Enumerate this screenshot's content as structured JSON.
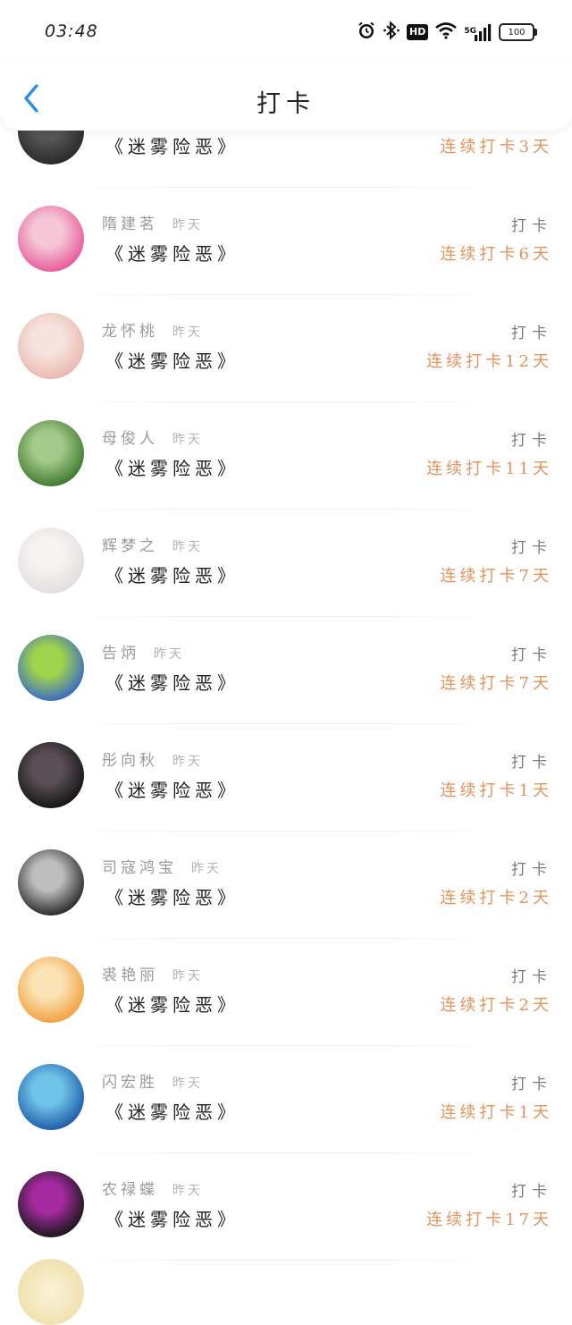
{
  "status_bar": {
    "time": "03:48",
    "icons": [
      "alarm-icon",
      "bluetooth-icon",
      "hd-icon",
      "wifi-icon",
      "5g-signal-icon",
      "battery-icon"
    ],
    "hd_label": "HD",
    "network_label": "5G",
    "battery_level": "100"
  },
  "header": {
    "title": "打卡",
    "back_icon": "chevron-left-icon",
    "accent_color": "#2f8fe0"
  },
  "colors": {
    "streak": "#e3935c",
    "name": "#9a9a9a",
    "checkin": "#7d7d7d"
  },
  "records": [
    {
      "name": "",
      "time": "",
      "book": "《迷雾险恶》",
      "checkin": "",
      "streak": "连续打卡3天",
      "avatar_colors": [
        "#2a2a2a",
        "#555555"
      ]
    },
    {
      "name": "隋建茗",
      "time": "昨天",
      "book": "《迷雾险恶》",
      "checkin": "打卡",
      "streak": "连续打卡6天",
      "avatar_colors": [
        "#e85a9a",
        "#f4c6d6"
      ]
    },
    {
      "name": "龙怀桃",
      "time": "昨天",
      "book": "《迷雾险恶》",
      "checkin": "打卡",
      "streak": "连续打卡12天",
      "avatar_colors": [
        "#e9b9b0",
        "#f7e3dd"
      ]
    },
    {
      "name": "母俊人",
      "time": "昨天",
      "book": "《迷雾险恶》",
      "checkin": "打卡",
      "streak": "连续打卡11天",
      "avatar_colors": [
        "#3f7a2e",
        "#a4c98a"
      ]
    },
    {
      "name": "辉梦之",
      "time": "昨天",
      "book": "《迷雾险恶》",
      "checkin": "打卡",
      "streak": "连续打卡7天",
      "avatar_colors": [
        "#e2dede",
        "#f6f3f3"
      ]
    },
    {
      "name": "告炳",
      "time": "昨天",
      "book": "《迷雾险恶》",
      "checkin": "打卡",
      "streak": "连续打卡7天",
      "avatar_colors": [
        "#3a6bc4",
        "#9fd34b"
      ]
    },
    {
      "name": "彤向秋",
      "time": "昨天",
      "book": "《迷雾险恶》",
      "checkin": "打卡",
      "streak": "连续打卡1天",
      "avatar_colors": [
        "#151515",
        "#5a4f55"
      ]
    },
    {
      "name": "司寇鸿宝",
      "time": "昨天",
      "book": "《迷雾险恶》",
      "checkin": "打卡",
      "streak": "连续打卡2天",
      "avatar_colors": [
        "#2a2a2a",
        "#bdbdbd"
      ]
    },
    {
      "name": "裘艳丽",
      "time": "昨天",
      "book": "《迷雾险恶》",
      "checkin": "打卡",
      "streak": "连续打卡2天",
      "avatar_colors": [
        "#f2a041",
        "#fbe3b5"
      ]
    },
    {
      "name": "闪宏胜",
      "time": "昨天",
      "book": "《迷雾险恶》",
      "checkin": "打卡",
      "streak": "连续打卡1天",
      "avatar_colors": [
        "#1f5ca8",
        "#6fc3e8"
      ]
    },
    {
      "name": "农禄蝶",
      "time": "昨天",
      "book": "《迷雾险恶》",
      "checkin": "打卡",
      "streak": "连续打卡17天",
      "avatar_colors": [
        "#181818",
        "#a52aa0"
      ]
    }
  ]
}
